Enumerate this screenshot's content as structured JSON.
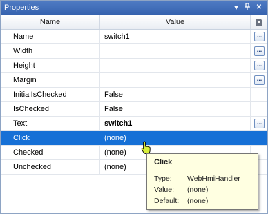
{
  "titlebar": {
    "title": "Properties",
    "dropdown_icon": "dropdown-arrow-icon",
    "pin_icon": "pin-icon",
    "close_icon": "close-icon"
  },
  "header": {
    "name_label": "Name",
    "value_label": "Value",
    "icon": "property-pages-icon"
  },
  "rows": [
    {
      "name": "Name",
      "value": "switch1",
      "button": "..."
    },
    {
      "name": "Width",
      "value": "",
      "button": "..."
    },
    {
      "name": "Height",
      "value": "",
      "button": "..."
    },
    {
      "name": "Margin",
      "value": "",
      "button": "..."
    },
    {
      "name": "InitialIsChecked",
      "value": "False"
    },
    {
      "name": "IsChecked",
      "value": "False"
    },
    {
      "name": "Text",
      "value": "switch1",
      "button": "..."
    },
    {
      "name": "Click",
      "value": "(none)"
    },
    {
      "name": "Checked",
      "value": "(none)"
    },
    {
      "name": "Unchecked",
      "value": "(none)"
    }
  ],
  "tooltip": {
    "title": "Click",
    "lines": [
      {
        "key": "Type:",
        "value": "WebHmiHandler"
      },
      {
        "key": "Value:",
        "value": "(none)"
      },
      {
        "key": "Default:",
        "value": "(none)"
      }
    ]
  },
  "colors": {
    "titlebar": "#4a76bf",
    "selection": "#1670d6",
    "tooltip_bg": "#ffffe1"
  }
}
